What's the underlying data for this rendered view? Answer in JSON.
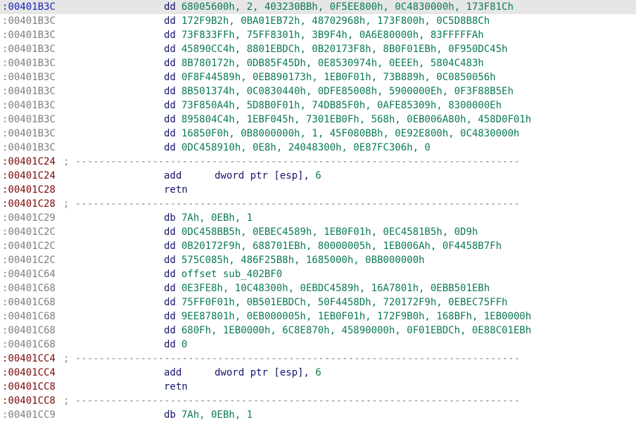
{
  "listing": [
    {
      "addr": ":00401B3C",
      "kind": "selected",
      "mnem": "dd",
      "op1": "",
      "rest": "68005600h, 2, 403230BBh, 0F5EE800h, 0C4830000h, 173F81Ch"
    },
    {
      "addr": ":00401B3C",
      "kind": "data",
      "mnem": "dd",
      "op1": "",
      "rest": "172F9B2h, 0BA01EB72h, 48702968h, 173F800h, 0C5D8B8Ch"
    },
    {
      "addr": ":00401B3C",
      "kind": "data",
      "mnem": "dd",
      "op1": "",
      "rest": "73F833FFh, 75FF8301h, 3B9F4h, 0A6E80000h, 83FFFFFAh"
    },
    {
      "addr": ":00401B3C",
      "kind": "data",
      "mnem": "dd",
      "op1": "",
      "rest": "45890CC4h, 8801EBDCh, 0B20173F8h, 8B0F01EBh, 0F950DC45h"
    },
    {
      "addr": ":00401B3C",
      "kind": "data",
      "mnem": "dd",
      "op1": "",
      "rest": "8B780172h, 0DB85F45Dh, 0E8530974h, 0EEEh, 5804C483h"
    },
    {
      "addr": ":00401B3C",
      "kind": "data",
      "mnem": "dd",
      "op1": "",
      "rest": "0F8F44589h, 0EB890173h, 1EB0F01h, 73B889h, 0C0850056h"
    },
    {
      "addr": ":00401B3C",
      "kind": "data",
      "mnem": "dd",
      "op1": "",
      "rest": "8B501374h, 0C0830440h, 0DFE85008h, 5900000Eh, 0F3F88B5Eh"
    },
    {
      "addr": ":00401B3C",
      "kind": "data",
      "mnem": "dd",
      "op1": "",
      "rest": "73F850A4h, 5D8B0F01h, 74DB85F0h, 0AFE85309h, 8300000Eh"
    },
    {
      "addr": ":00401B3C",
      "kind": "data",
      "mnem": "dd",
      "op1": "",
      "rest": "895804C4h, 1EBF045h, 7301EB0Fh, 568h, 0EB006A80h, 458D0F01h"
    },
    {
      "addr": ":00401B3C",
      "kind": "data",
      "mnem": "dd",
      "op1": "",
      "rest": "16850F0h, 0B8000000h, 1, 45F080BBh, 0E92E800h, 0C4830000h"
    },
    {
      "addr": ":00401B3C",
      "kind": "data",
      "mnem": "dd",
      "op1": "",
      "rest": "0DC458910h, 0E8h, 24048300h, 0E87FC306h, 0"
    },
    {
      "addr": ":00401C24",
      "kind": "code",
      "sep": "; ---------------------------------------------------------------------------"
    },
    {
      "addr": ":00401C24",
      "kind": "code",
      "mnem": "add",
      "op1": "dword ptr [esp],",
      "rest": " 6"
    },
    {
      "addr": ":00401C28",
      "kind": "code",
      "mnem": "retn",
      "op1": "",
      "rest": ""
    },
    {
      "addr": ":00401C28",
      "kind": "code",
      "sep": "; ---------------------------------------------------------------------------"
    },
    {
      "addr": ":00401C29",
      "kind": "data",
      "mnem": "db",
      "op1": "",
      "rest": "7Ah, 0EBh, 1"
    },
    {
      "addr": ":00401C2C",
      "kind": "data",
      "mnem": "dd",
      "op1": "",
      "rest": "0DC458BB5h, 0EBEC4589h, 1EB0F01h, 0EC4581B5h, 0D9h"
    },
    {
      "addr": ":00401C2C",
      "kind": "data",
      "mnem": "dd",
      "op1": "",
      "rest": "0B20172F9h, 688701EBh, 80000005h, 1EB006Ah, 0F4458B7Fh"
    },
    {
      "addr": ":00401C2C",
      "kind": "data",
      "mnem": "dd",
      "op1": "",
      "rest": "575C085h, 486F25B8h, 1685000h, 0BB000000h"
    },
    {
      "addr": ":00401C64",
      "kind": "data",
      "mnem": "dd",
      "op1": "",
      "rest": "offset sub_402BF0"
    },
    {
      "addr": ":00401C68",
      "kind": "data",
      "mnem": "dd",
      "op1": "",
      "rest": "0E3FE8h, 10C48300h, 0EBDC4589h, 16A7801h, 0EBB501EBh"
    },
    {
      "addr": ":00401C68",
      "kind": "data",
      "mnem": "dd",
      "op1": "",
      "rest": "75FF0F01h, 0B501EBDCh, 50F4458Dh, 720172F9h, 0EBEC75FFh"
    },
    {
      "addr": ":00401C68",
      "kind": "data",
      "mnem": "dd",
      "op1": "",
      "rest": "9EE87801h, 0EB000005h, 1EB0F01h, 172F9B0h, 168BFh, 1EB0000h"
    },
    {
      "addr": ":00401C68",
      "kind": "data",
      "mnem": "dd",
      "op1": "",
      "rest": "680Fh, 1EB0000h, 6C8E870h, 45890000h, 0F01EBDCh, 0E88C01EBh"
    },
    {
      "addr": ":00401C68",
      "kind": "data",
      "mnem": "dd",
      "op1": "",
      "rest": "0"
    },
    {
      "addr": ":00401CC4",
      "kind": "code",
      "sep": "; ---------------------------------------------------------------------------"
    },
    {
      "addr": ":00401CC4",
      "kind": "code",
      "mnem": "add",
      "op1": "dword ptr [esp],",
      "rest": " 6"
    },
    {
      "addr": ":00401CC8",
      "kind": "code",
      "mnem": "retn",
      "op1": "",
      "rest": ""
    },
    {
      "addr": ":00401CC8",
      "kind": "code",
      "sep": "; ---------------------------------------------------------------------------"
    },
    {
      "addr": ":00401CC9",
      "kind": "data",
      "mnem": "db",
      "op1": "",
      "rest": "7Ah, 0EBh, 1"
    }
  ],
  "colors": {
    "code_address": "#7a0a0a",
    "data_address": "#7e7e7e",
    "selected_address": "#1a24b4",
    "mnemonic": "#15156e",
    "operand": "#0a7a55",
    "separator": "#8a8a8a",
    "selection_background": "#e6e6e6"
  }
}
